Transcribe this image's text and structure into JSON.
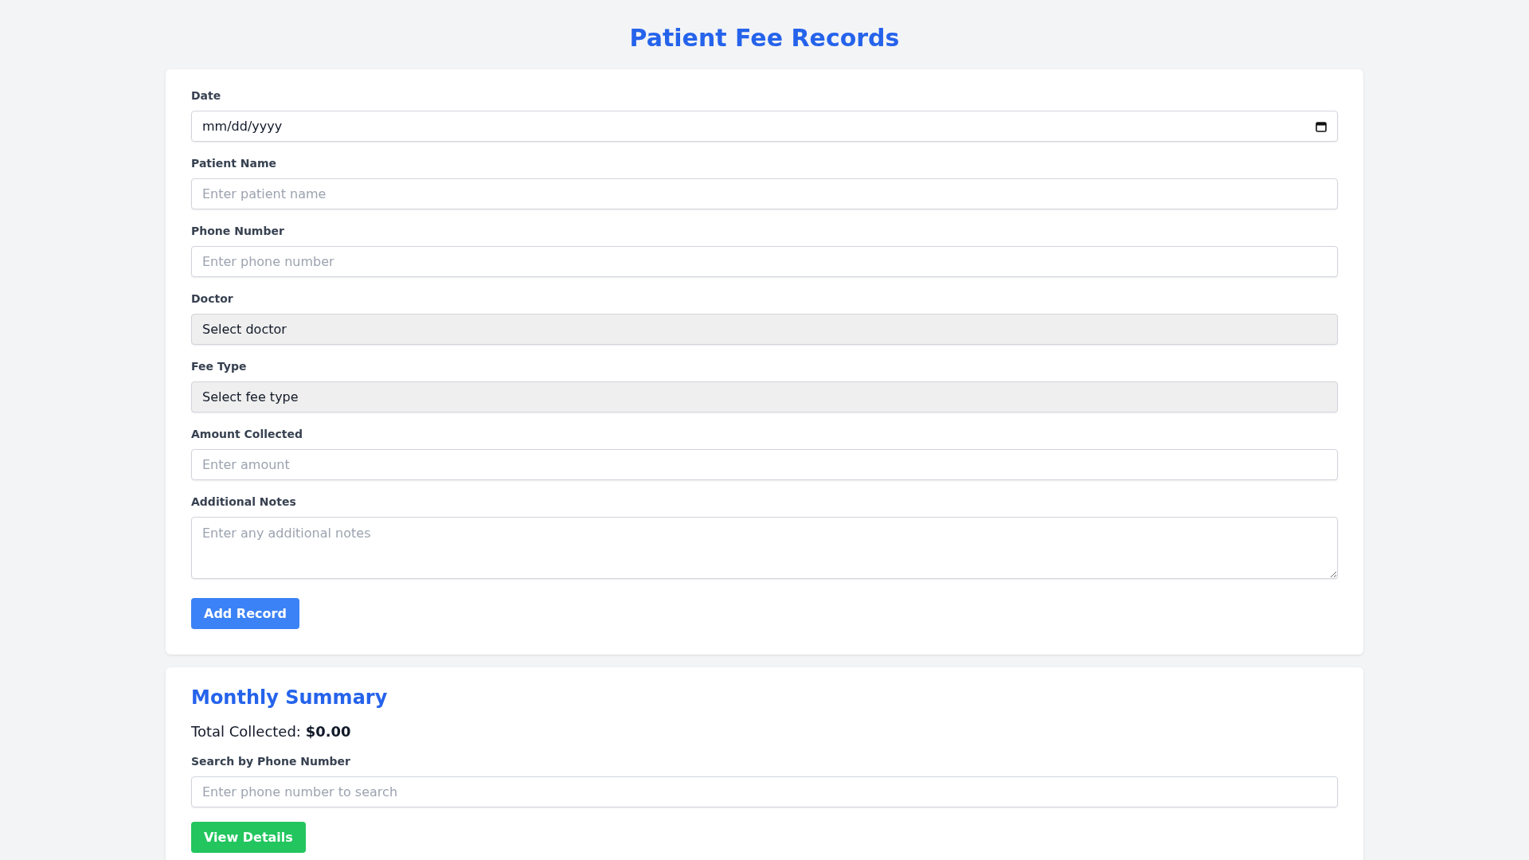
{
  "title": "Patient Fee Records",
  "form": {
    "fields": [
      {
        "kind": "date",
        "label": "Date",
        "value": "mm/dd/yyyy"
      },
      {
        "kind": "text",
        "label": "Patient Name",
        "placeholder": "Enter patient name"
      },
      {
        "kind": "text",
        "label": "Phone Number",
        "placeholder": "Enter phone number"
      },
      {
        "kind": "select",
        "label": "Doctor",
        "value": "Select doctor"
      },
      {
        "kind": "select",
        "label": "Fee Type",
        "value": "Select fee type"
      },
      {
        "kind": "text",
        "label": "Amount Collected",
        "placeholder": "Enter amount"
      },
      {
        "kind": "textarea",
        "label": "Additional Notes",
        "placeholder": "Enter any additional notes"
      }
    ],
    "submit_button": "Add Record"
  },
  "summary": {
    "title": "Monthly Summary",
    "total_label": "Total Collected:",
    "total_value": "$0.00",
    "search_label": "Search by Phone Number",
    "search_placeholder": "Enter phone number to search",
    "button": "View Details"
  }
}
